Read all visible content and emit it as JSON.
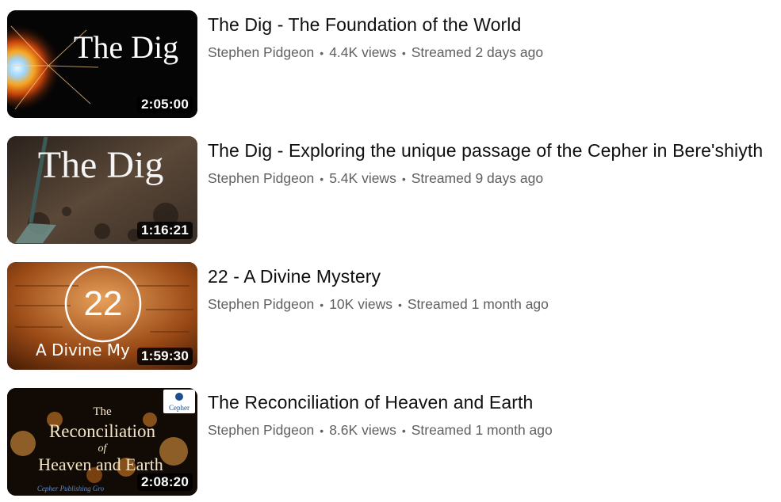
{
  "videos": [
    {
      "title": "The Dig - The Foundation of the World",
      "channel": "Stephen Pidgeon",
      "views": "4.4K views",
      "age": "Streamed 2 days ago",
      "duration": "2:05:00",
      "thumb_text": "The Dig",
      "thumb_colors": {
        "bg": "#050505",
        "glow": "#f6a623",
        "core": "#bfe6ff"
      }
    },
    {
      "title": "The Dig - Exploring the unique passage of the Cepher in Bere'shiyth",
      "channel": "Stephen Pidgeon",
      "views": "5.4K views",
      "age": "Streamed 9 days ago",
      "duration": "1:16:21",
      "thumb_text": "The Dig",
      "thumb_colors": {
        "bg": "#3d3128",
        "soil": "#5a4838",
        "shovel": "#6e8f89"
      }
    },
    {
      "title": "22 - A Divine Mystery",
      "channel": "Stephen Pidgeon",
      "views": "10K views",
      "age": "Streamed 1 month ago",
      "duration": "1:59:30",
      "thumb_number": "22",
      "thumb_caption": "A Divine My",
      "thumb_colors": {
        "bg": "#9a4a16",
        "light": "#e7a05a"
      }
    },
    {
      "title": "The Reconciliation of Heaven and Earth",
      "channel": "Stephen Pidgeon",
      "views": "8.6K views",
      "age": "Streamed 1 month ago",
      "duration": "2:08:20",
      "thumb_lines": [
        "The",
        "Reconciliation",
        "of",
        "Heaven and Earth"
      ],
      "thumb_logo": "Cepher",
      "thumb_footer": "Cepher Publishing Gro",
      "thumb_colors": {
        "bg": "#120a04",
        "candle": "#f3a447",
        "text": "#f3e6c7"
      }
    }
  ],
  "separator": "•"
}
